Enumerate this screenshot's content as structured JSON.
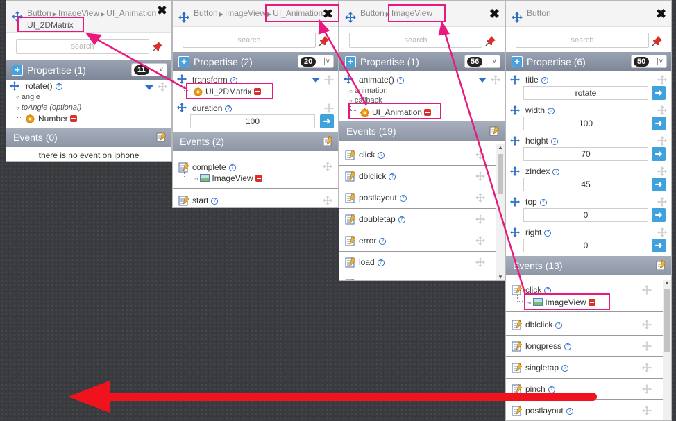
{
  "panel1": {
    "breadcrumb": [
      "Button",
      "ImageView",
      "UI_Animation"
    ],
    "title": "UI_2DMatrix",
    "search_placeholder": "search",
    "props_label": "Propertise (1)",
    "count": "11",
    "method": "rotate()",
    "arg1": "angle",
    "arg2": "toAngle (optional)",
    "arg3": "Number",
    "events_label": "Events (0)",
    "empty_text": "there is no event on iphone"
  },
  "panel2": {
    "breadcrumb": [
      "Button",
      "ImageView"
    ],
    "crumb_current": "UI_Animation",
    "search_placeholder": "search",
    "props_label": "Propertise (2)",
    "count": "20",
    "prop1": "transform",
    "prop1_child": "UI_2DMatrix",
    "prop2": "duration",
    "prop2_value": "100",
    "events_label": "Events (2)",
    "ev1": "complete",
    "ev1_child": "ImageView",
    "ev2": "start"
  },
  "panel3": {
    "breadcrumb": [
      "Button"
    ],
    "crumb_current": "ImageView",
    "search_placeholder": "search",
    "props_label": "Propertise (1)",
    "count": "56",
    "method": "animate()",
    "arg1": "animation",
    "arg2": "callback",
    "arg_child": "UI_Animation",
    "events_label": "Events (19)",
    "events": [
      "click",
      "dblclick",
      "postlayout",
      "doubletap",
      "error",
      "load"
    ]
  },
  "panel4": {
    "breadcrumb": "Button",
    "search_placeholder": "search",
    "props_label": "Propertise (6)",
    "count": "50",
    "props": [
      {
        "name": "title",
        "value": "rotate"
      },
      {
        "name": "width",
        "value": "100"
      },
      {
        "name": "height",
        "value": "70"
      },
      {
        "name": "zIndex",
        "value": "45"
      },
      {
        "name": "top",
        "value": "0"
      },
      {
        "name": "right",
        "value": "0"
      }
    ],
    "events_label": "Events (13)",
    "ev_click": "click",
    "ev_click_child": "ImageView",
    "events": [
      "dblclick",
      "longpress",
      "singletap",
      "pinch",
      "postlayout"
    ]
  },
  "colors": {
    "highlight": "#e8197d",
    "arrow": "#f0121c",
    "section": "#8a93a4",
    "go_button": "#3fa2dd"
  },
  "icons": [
    "move-icon",
    "close-icon",
    "search-icon",
    "pin-icon",
    "plus-icon",
    "help-icon",
    "gear-icon",
    "remove-icon",
    "image-icon",
    "link-icon",
    "note-icon",
    "event-icon",
    "go-arrow-icon",
    "chevron-down-icon"
  ]
}
